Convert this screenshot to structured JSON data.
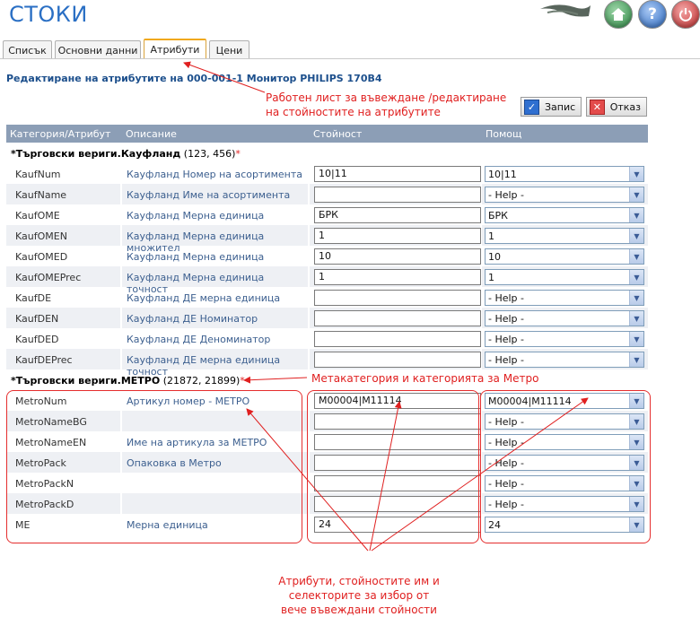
{
  "app": {
    "title": "СТОКИ"
  },
  "tabs": [
    {
      "label": "Списък"
    },
    {
      "label": "Основни данни"
    },
    {
      "label": "Атрибути"
    },
    {
      "label": "Цени"
    }
  ],
  "page": {
    "title": "Редактиране на атрибутите на 000-001-1 Монитор PHILIPS 170B4"
  },
  "actions": {
    "save": "Запис",
    "cancel": "Отказ"
  },
  "table": {
    "headers": [
      "Категория/Атрибут",
      "Описание",
      "Стойност",
      "Помощ"
    ],
    "groups": [
      {
        "name": "*Търговски вериги.Кауфланд",
        "codes": "(123, 456)",
        "star": "*",
        "rows": [
          {
            "attr": "KaufNum",
            "desc": "Кауфланд Номер на асортимента",
            "value": "10|11",
            "help": "10|11"
          },
          {
            "attr": "KaufName",
            "desc": "Кауфланд Име на асортимента",
            "value": "",
            "help": "- Help -"
          },
          {
            "attr": "KaufOME",
            "desc": "Кауфланд Мерна единица",
            "value": "БРК",
            "help": "БРК"
          },
          {
            "attr": "KaufOMEN",
            "desc": "Кауфланд Мерна единица множител",
            "value": "1",
            "help": "1"
          },
          {
            "attr": "KaufOMED",
            "desc": "Кауфланд Мерна единица делител",
            "value": "10",
            "help": "10"
          },
          {
            "attr": "KaufOMEPrec",
            "desc": "Кауфланд Мерна единица точност",
            "value": "1",
            "help": "1"
          },
          {
            "attr": "KaufDE",
            "desc": "Кауфланд ДЕ мерна единица",
            "value": "",
            "help": "- Help -"
          },
          {
            "attr": "KaufDEN",
            "desc": "Кауфланд ДЕ Номинатор",
            "value": "",
            "help": "- Help -"
          },
          {
            "attr": "KaufDED",
            "desc": "Кауфланд ДЕ Деноминатор",
            "value": "",
            "help": "- Help -"
          },
          {
            "attr": "KaufDEPrec",
            "desc": "Кауфланд ДЕ мерна единица точност",
            "value": "",
            "help": "- Help -"
          }
        ]
      },
      {
        "name": "*Търговски вериги.МЕТРО",
        "codes": "(21872, 21899)",
        "star": "*",
        "rows": [
          {
            "attr": "MetroNum",
            "desc": "Артикул номер - МЕТРО",
            "value": "M00004|M11114",
            "help": "M00004|M11114"
          },
          {
            "attr": "MetroNameBG",
            "desc": "",
            "value": "",
            "help": "- Help -"
          },
          {
            "attr": "MetroNameEN",
            "desc": "Име на артикула за МЕТРО",
            "value": "",
            "help": "- Help -"
          },
          {
            "attr": "MetroPack",
            "desc": "Опаковка в Метро",
            "value": "",
            "help": "- Help -"
          },
          {
            "attr": "MetroPackN",
            "desc": "",
            "value": "",
            "help": "- Help -"
          },
          {
            "attr": "MetroPackD",
            "desc": "",
            "value": "",
            "help": "- Help -"
          },
          {
            "attr": "ME",
            "desc": "Мерна единица",
            "value": "24",
            "help": "24"
          }
        ]
      }
    ]
  },
  "annotations": {
    "worksheet_line1": "Работен лист за въвеждане /редактиране",
    "worksheet_line2": "на стойностите на атрибутите",
    "metacategory": "Метакатегория и категорията за Метро",
    "attributes_line1": "Атрибути, стойностите им и",
    "attributes_line2": "селекторите за избор от",
    "attributes_line3": "вече въвеждани стойности"
  },
  "colors": {
    "accent": "#2a6fc4",
    "header_bg": "#8c9eb6",
    "annotation": "#e02020",
    "tab_active": "#f0a81c"
  },
  "icons": {
    "home": "home-icon",
    "help": "question-icon",
    "power": "power-icon",
    "save": "check-icon",
    "cancel": "cancel-icon",
    "dropdown": "chevron-down-icon"
  }
}
